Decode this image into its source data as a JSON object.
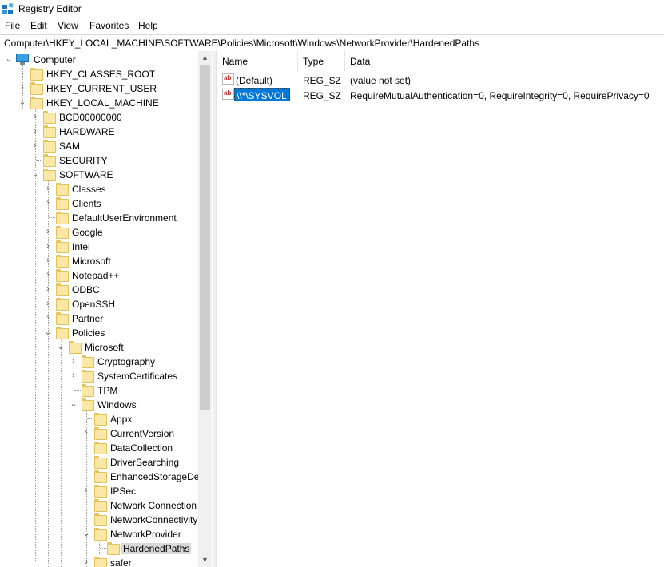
{
  "window": {
    "title": "Registry Editor"
  },
  "menu": {
    "items": [
      "File",
      "Edit",
      "View",
      "Favorites",
      "Help"
    ]
  },
  "address": {
    "path": "Computer\\HKEY_LOCAL_MACHINE\\SOFTWARE\\Policies\\Microsoft\\Windows\\NetworkProvider\\HardenedPaths"
  },
  "tree": {
    "items": [
      {
        "label": "Computer",
        "expanded": true
      },
      {
        "label": "HKEY_CLASSES_ROOT"
      },
      {
        "label": "HKEY_CURRENT_USER"
      },
      {
        "label": "HKEY_LOCAL_MACHINE",
        "expanded": true
      },
      {
        "label": "BCD00000000"
      },
      {
        "label": "HARDWARE"
      },
      {
        "label": "SAM"
      },
      {
        "label": "SECURITY"
      },
      {
        "label": "SOFTWARE",
        "expanded": true
      },
      {
        "label": "Classes"
      },
      {
        "label": "Clients"
      },
      {
        "label": "DefaultUserEnvironment"
      },
      {
        "label": "Google"
      },
      {
        "label": "Intel"
      },
      {
        "label": "Microsoft"
      },
      {
        "label": "Notepad++"
      },
      {
        "label": "ODBC"
      },
      {
        "label": "OpenSSH"
      },
      {
        "label": "Partner"
      },
      {
        "label": "Policies",
        "expanded": true
      },
      {
        "label": "Microsoft",
        "expanded": true
      },
      {
        "label": "Cryptography"
      },
      {
        "label": "SystemCertificates"
      },
      {
        "label": "TPM"
      },
      {
        "label": "Windows",
        "expanded": true
      },
      {
        "label": "Appx"
      },
      {
        "label": "CurrentVersion"
      },
      {
        "label": "DataCollection"
      },
      {
        "label": "DriverSearching"
      },
      {
        "label": "EnhancedStorageDev"
      },
      {
        "label": "IPSec"
      },
      {
        "label": "Network Connection"
      },
      {
        "label": "NetworkConnectivity"
      },
      {
        "label": "NetworkProvider",
        "expanded": true
      },
      {
        "label": "HardenedPaths",
        "selected": true
      },
      {
        "label": "safer"
      }
    ]
  },
  "list": {
    "columns": [
      "Name",
      "Type",
      "Data"
    ],
    "rows": [
      {
        "name": "(Default)",
        "type": "REG_SZ",
        "data": "(value not set)",
        "icon": "string-value-icon"
      },
      {
        "name": "\\\\*\\SYSVOL",
        "type": "REG_SZ",
        "data": "RequireMutualAuthentication=0, RequireIntegrity=0, RequirePrivacy=0",
        "icon": "string-value-icon",
        "selected": true
      }
    ],
    "icon_text": "ab"
  },
  "colors": {
    "selection": "#0078d7",
    "tree_selected": "#d9d9d9",
    "folder": "#fce8a6"
  }
}
